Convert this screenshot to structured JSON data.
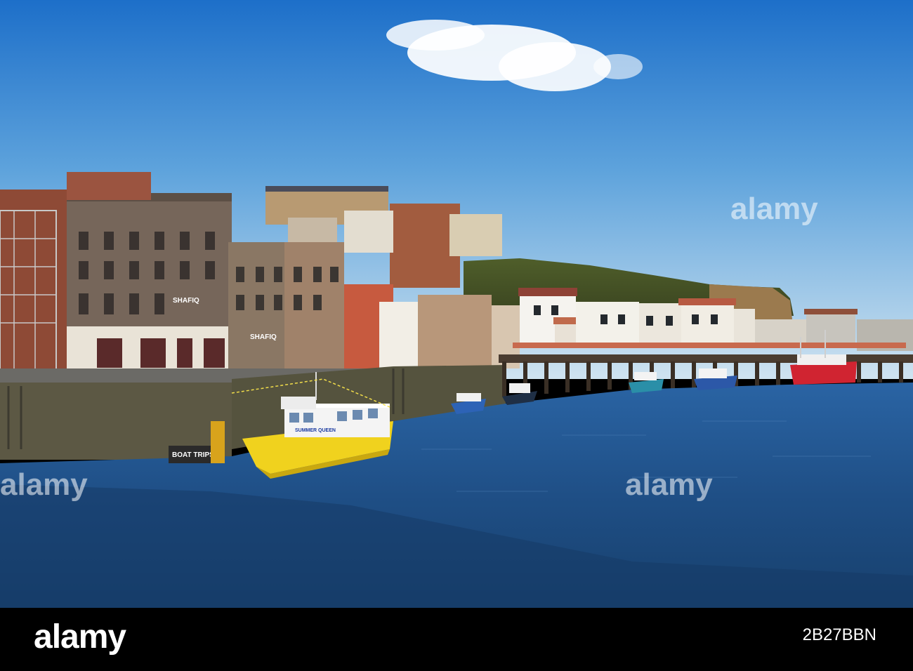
{
  "photo": {
    "subject": "Harbour waterfront with moored boats and hillside town",
    "colors": {
      "sky_top": "#1d6fc9",
      "sky_bottom": "#cfe3f0",
      "water": "#1f4f86",
      "hull_yellow": "#f0d21e",
      "hull_red": "#d02431"
    }
  },
  "signs": {
    "shop_sign": "SHAFIQ",
    "shop_sign_lower": "SHAFIQ",
    "boat_name": "SUMMER QUEEN",
    "kiosk_sign": "BOAT TRIPS"
  },
  "watermarks": {
    "top_right": "alamy",
    "left": "alamy",
    "center": "alamy"
  },
  "footer": {
    "logo": "alamy",
    "image_id": "2B27BBN"
  }
}
